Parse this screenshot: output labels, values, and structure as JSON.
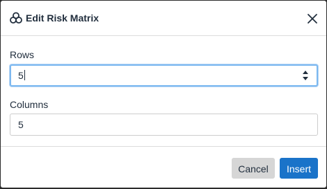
{
  "dialog": {
    "title": "Edit Risk Matrix",
    "title_icon": "risk-matrix-icon",
    "close_icon": "close-icon"
  },
  "form": {
    "rows": {
      "label": "Rows",
      "value": "5",
      "control": "number-spinner"
    },
    "columns": {
      "label": "Columns",
      "value": "5"
    }
  },
  "footer": {
    "cancel_label": "Cancel",
    "insert_label": "Insert"
  },
  "colors": {
    "primary": "#1a73c9",
    "secondary_button": "#d6d6d6",
    "focus_ring": "#7cb8f0",
    "text": "#222f3e"
  }
}
